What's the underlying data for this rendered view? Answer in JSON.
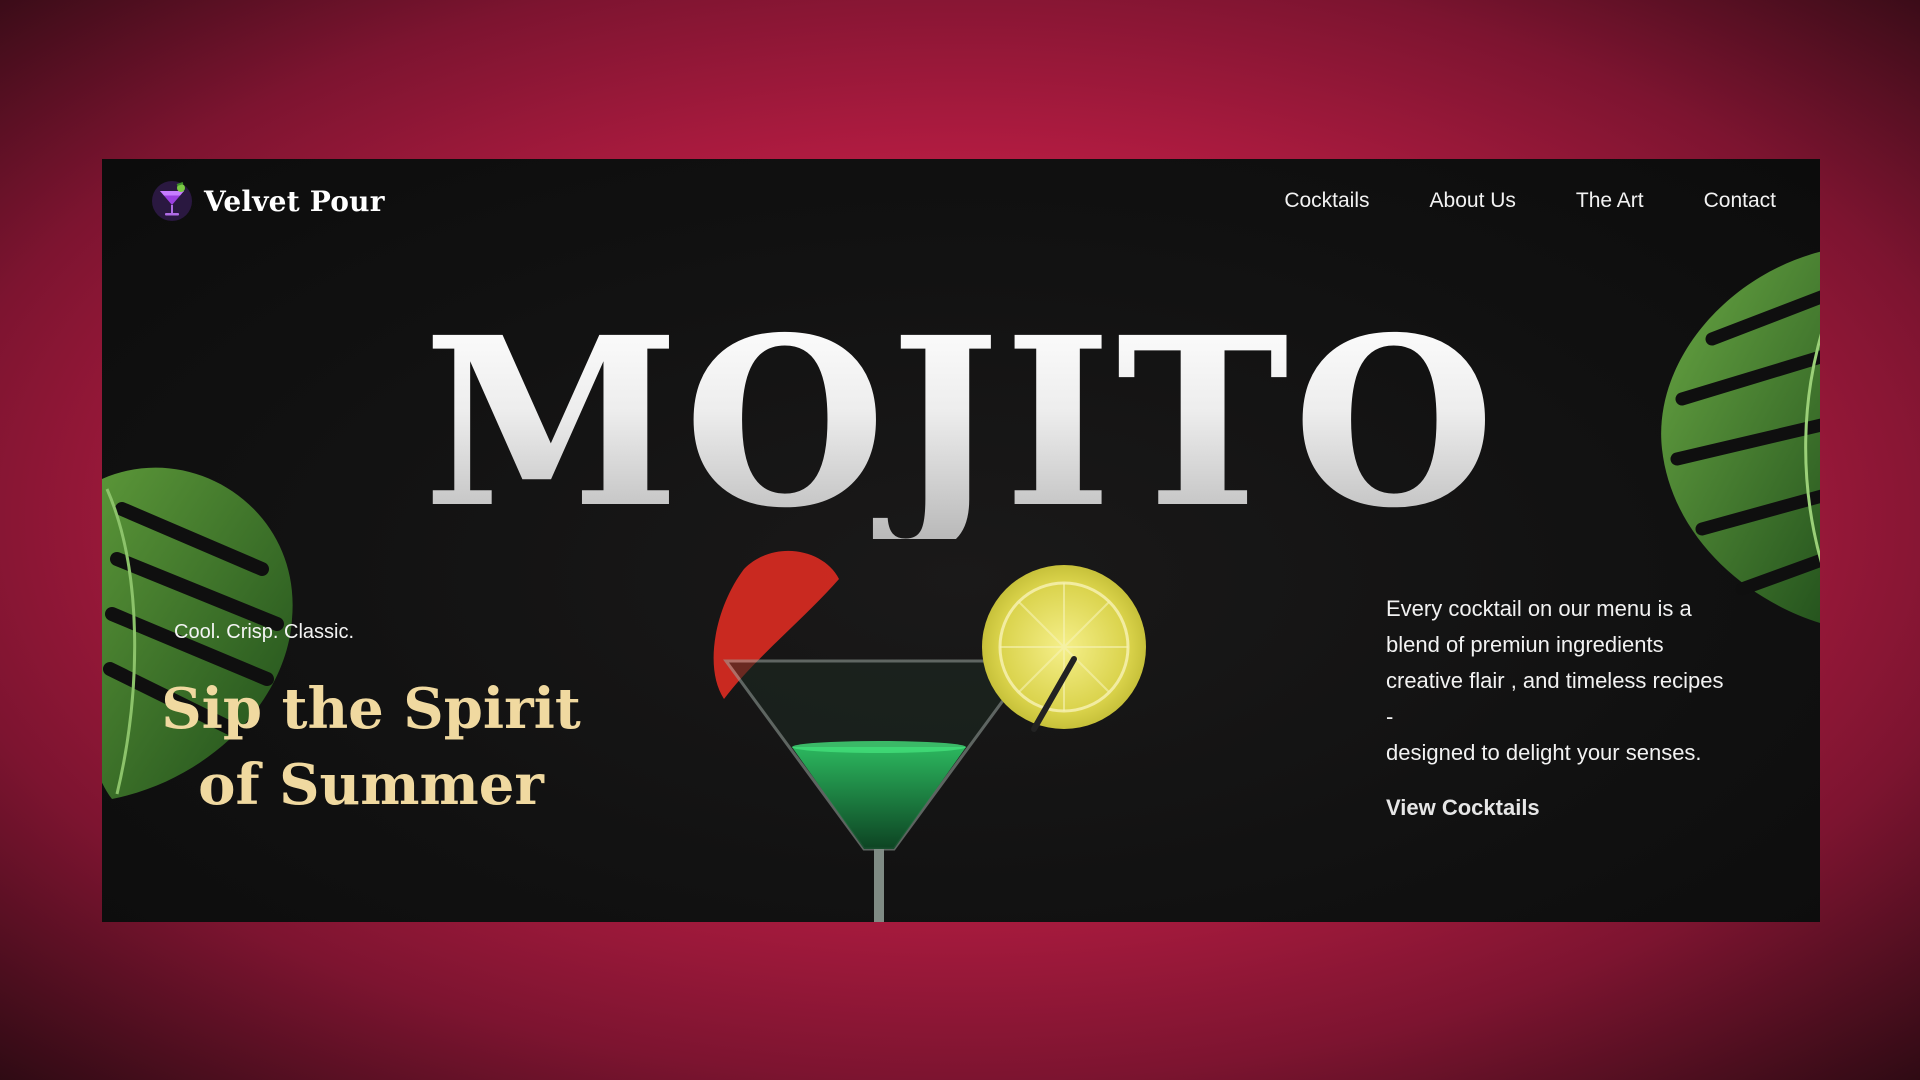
{
  "brand": {
    "name": "Velvet Pour",
    "logo_icon": "cocktail-glass-icon"
  },
  "nav": {
    "items": [
      {
        "label": "Cocktails"
      },
      {
        "label": "About Us"
      },
      {
        "label": "The Art"
      },
      {
        "label": "Contact"
      }
    ]
  },
  "hero": {
    "title": "MOJITO",
    "tagline": "Cool. Crisp. Classic.",
    "headline_line1": "Sip the Spirit",
    "headline_line2": "of Summer",
    "description": "Every cocktail on our menu is a\nblend of premiun ingredients\ncreative flair , and timeless recipes\n-\ndesigned to delight your senses.",
    "cta_label": "View Cocktails"
  },
  "colors": {
    "page_background": "#b41c42",
    "frame_background": "#111111",
    "accent_gold": "#f0d9a0",
    "text": "#f2f2f2"
  }
}
